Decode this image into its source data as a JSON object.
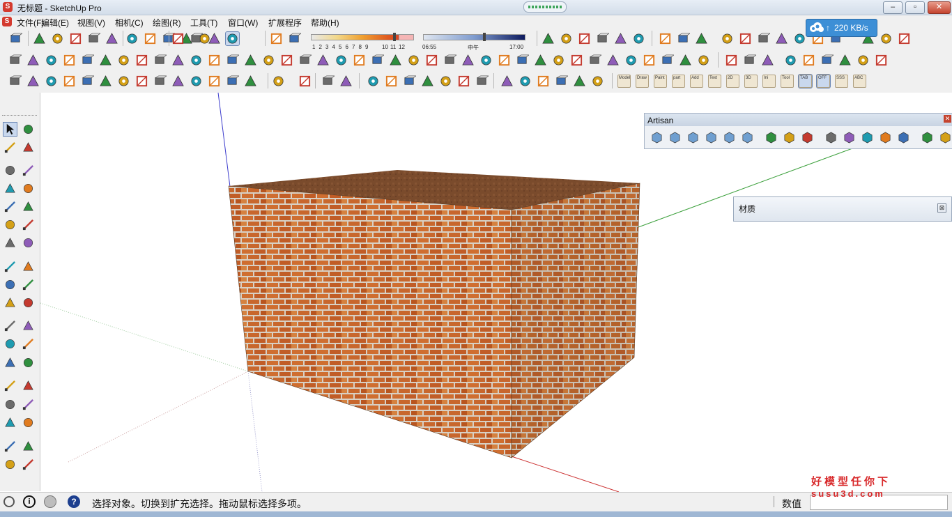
{
  "window": {
    "title": "无标题 - SketchUp Pro",
    "minimize": "–",
    "maximize": "▫",
    "close": "✕"
  },
  "menu": [
    {
      "label": "文件(F)"
    },
    {
      "label": "编辑(E)"
    },
    {
      "label": "视图(V)"
    },
    {
      "label": "相机(C)"
    },
    {
      "label": "绘图(R)"
    },
    {
      "label": "工具(T)"
    },
    {
      "label": "窗口(W)"
    },
    {
      "label": "扩展程序"
    },
    {
      "label": "帮助(H)"
    }
  ],
  "shadow_toolbar": {
    "months": [
      "1",
      "2",
      "3",
      "4",
      "5",
      "6",
      "7",
      "8",
      "9",
      "10",
      "11",
      "12"
    ],
    "time_start": "06:55",
    "time_mid": "中午",
    "time_end": "17:00"
  },
  "network_speed": "220 KB/s",
  "row3_text_buttons": [
    "Model",
    "Draw",
    "Paint",
    "part",
    "Add",
    "Text",
    "2D",
    "3D",
    "Ini",
    "Tool",
    "TAB",
    "OFF",
    "SSS",
    "ABC"
  ],
  "artisan": {
    "title": "Artisan",
    "close": "✕"
  },
  "materials": {
    "title": "材质",
    "close": "⊠"
  },
  "status": {
    "hint": "选择对象。切换到扩充选择。拖动鼠标选择多项。",
    "value_label": "数值",
    "value": ""
  },
  "watermark": {
    "line1": "好模型任你下",
    "line2": "susu3d.com"
  },
  "colors": {
    "accent": "#3d8fd6",
    "brick": "#c9692e",
    "roof": "#7a4b2c",
    "axis_red": "#cc3333",
    "axis_green": "#3ca03c",
    "axis_blue": "#3b3bcc"
  }
}
